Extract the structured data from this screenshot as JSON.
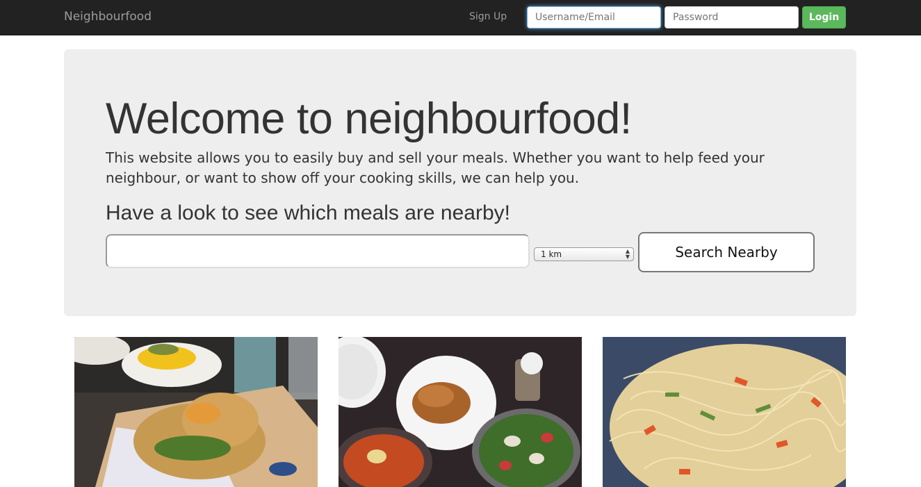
{
  "navbar": {
    "brand": "Neighbourfood",
    "signup_label": "Sign Up",
    "username_placeholder": "Username/Email",
    "password_placeholder": "Password",
    "login_label": "Login"
  },
  "hero": {
    "title": "Welcome to neighbourfood!",
    "description": "This website allows you to easily buy and sell your meals. Whether you want to help feed your neighbour, or want to show off your cooking skills, we can help you.",
    "subtitle": "Have a look to see which meals are nearby!",
    "search_value": "",
    "distance_selected": "1 km",
    "search_button_label": "Search Nearby"
  },
  "meals": [
    {
      "image": "burger-with-ramen-bun-and-corn-photo"
    },
    {
      "image": "roast-chicken-salad-and-stew-photo"
    },
    {
      "image": "stir-fried-noodles-pan-photo"
    }
  ],
  "colors": {
    "navbar_bg": "#222222",
    "login_green": "#5cb85c",
    "jumbotron_bg": "#eeeeee"
  }
}
